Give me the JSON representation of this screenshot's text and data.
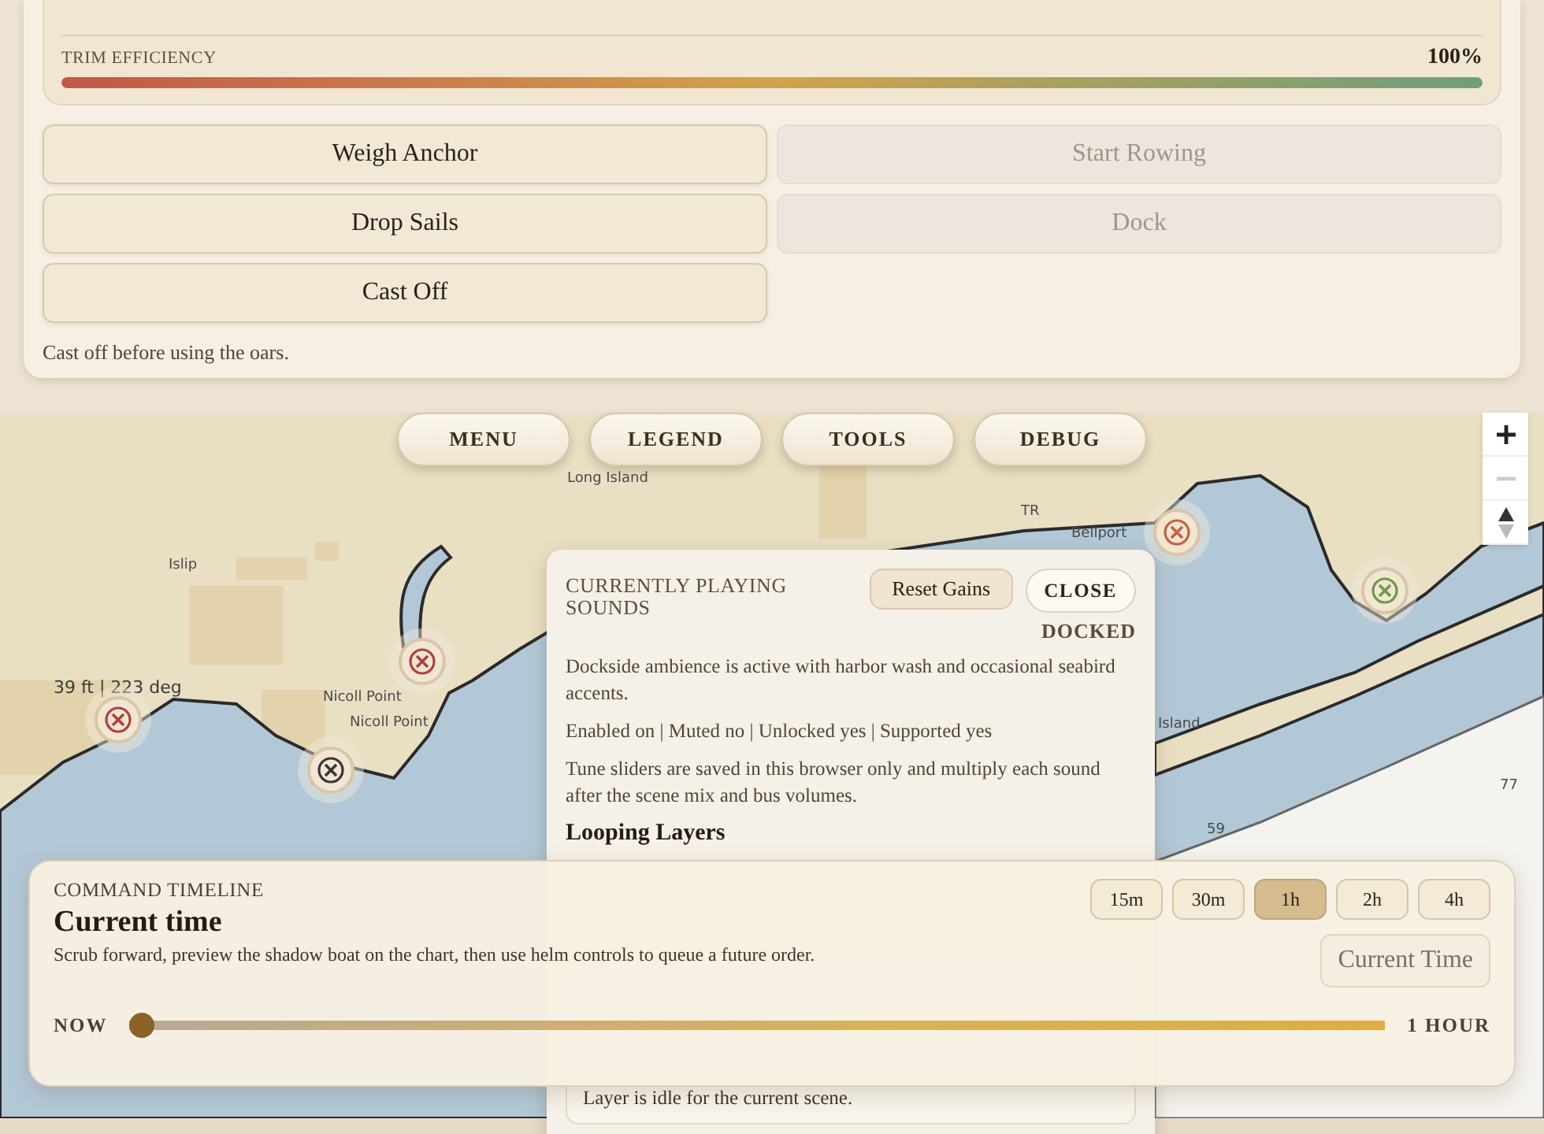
{
  "status_panel": {
    "trim": {
      "label": "TRIM EFFICIENCY",
      "reading": "100%",
      "level": 1
    },
    "actions": [
      {
        "label": "Weigh Anchor",
        "disabled": false
      },
      {
        "label": "Start Rowing",
        "disabled": true
      },
      {
        "label": "Drop Sails",
        "disabled": false
      },
      {
        "label": "Dock",
        "disabled": true
      },
      {
        "label": "Cast Off",
        "disabled": false
      }
    ],
    "note": "Cast off before using the oars."
  },
  "map_nav": [
    {
      "label": "MENU"
    },
    {
      "label": "LEGEND"
    },
    {
      "label": "TOOLS"
    },
    {
      "label": "DEBUG"
    }
  ],
  "map": {
    "labels": [
      {
        "text": "Long Island"
      },
      {
        "text": "Islip"
      },
      {
        "text": "Nicoll Point"
      },
      {
        "text": "Nicoll Point"
      },
      {
        "text": "Bellport"
      },
      {
        "text": "TR"
      },
      {
        "text": "Island"
      },
      {
        "text": "77"
      },
      {
        "text": "59"
      }
    ],
    "depth_label": "39 ft | 223 deg",
    "markers": [
      {
        "color": "#b0403a"
      },
      {
        "color": "#b0403a"
      },
      {
        "color": "#3a3630"
      },
      {
        "color": "#c9603a"
      },
      {
        "color": "#6e9a45"
      }
    ]
  },
  "sound_panel": {
    "title": "CURRENTLY PLAYING SOUNDS",
    "reset_button": "Reset Gains",
    "close_button": "CLOSE",
    "status": "DOCKED",
    "description": "Dockside ambience is active with harbor wash and occasional seabird accents.",
    "flags": "Enabled on | Muted no | Unlocked yes | Supported yes",
    "note": "Tune sliders are saved in this browser only and multiply each sound after the scene mix and bus volumes.",
    "section_heading": "Looping Layers",
    "layer_status": "Layer is idle for the current scene."
  },
  "timeline": {
    "eyebrow": "COMMAND TIMELINE",
    "title": "Current time",
    "description": "Scrub forward, preview the shadow boat on the chart, then use helm controls to queue a future order.",
    "ranges": [
      {
        "label": "15m",
        "selected": false
      },
      {
        "label": "30m",
        "selected": false
      },
      {
        "label": "1h",
        "selected": true
      },
      {
        "label": "2h",
        "selected": false
      },
      {
        "label": "4h",
        "selected": false
      }
    ],
    "current_time_button": "Current Time",
    "start_label": "NOW",
    "end_label": "1 HOUR",
    "scrubber": {
      "level": 0
    }
  }
}
